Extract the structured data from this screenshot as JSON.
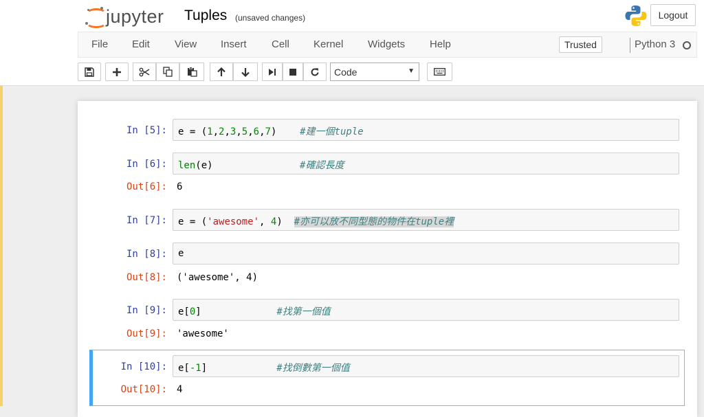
{
  "header": {
    "logo_text": "jupyter",
    "notebook_title": "Tuples",
    "autosave_status": "(unsaved changes)",
    "logout_label": "Logout"
  },
  "menubar": {
    "items": [
      "File",
      "Edit",
      "View",
      "Insert",
      "Cell",
      "Kernel",
      "Widgets",
      "Help"
    ],
    "trusted_label": "Trusted",
    "kernel_name": "Python 3"
  },
  "toolbar": {
    "cell_type": "Code",
    "cell_type_options": [
      "Code"
    ]
  },
  "cells": [
    {
      "in_prompt": "In [5]:",
      "tokens": [
        {
          "t": "e ",
          "c": "op"
        },
        {
          "t": "=",
          "c": "op"
        },
        {
          "t": " (",
          "c": "op"
        },
        {
          "t": "1",
          "c": "num"
        },
        {
          "t": ",",
          "c": "op"
        },
        {
          "t": "2",
          "c": "num"
        },
        {
          "t": ",",
          "c": "op"
        },
        {
          "t": "3",
          "c": "num"
        },
        {
          "t": ",",
          "c": "op"
        },
        {
          "t": "5",
          "c": "num"
        },
        {
          "t": ",",
          "c": "op"
        },
        {
          "t": "6",
          "c": "num"
        },
        {
          "t": ",",
          "c": "op"
        },
        {
          "t": "7",
          "c": "num"
        },
        {
          "t": ")    ",
          "c": "op"
        },
        {
          "t": "#建一個tuple",
          "c": "comment"
        }
      ],
      "out_prompt": "",
      "output": ""
    },
    {
      "in_prompt": "In [6]:",
      "tokens": [
        {
          "t": "len",
          "c": "fn"
        },
        {
          "t": "(e)               ",
          "c": "op"
        },
        {
          "t": "#確認長度",
          "c": "comment"
        }
      ],
      "out_prompt": "Out[6]:",
      "output": "6"
    },
    {
      "in_prompt": "In [7]:",
      "tokens": [
        {
          "t": "e ",
          "c": "op"
        },
        {
          "t": "=",
          "c": "op"
        },
        {
          "t": " (",
          "c": "op"
        },
        {
          "t": "'awesome'",
          "c": "str"
        },
        {
          "t": ", ",
          "c": "op"
        },
        {
          "t": "4",
          "c": "num"
        },
        {
          "t": ")  ",
          "c": "op"
        },
        {
          "t": "#亦可以放不同型態的物件在tuple裡",
          "c": "comment-hl"
        }
      ],
      "out_prompt": "",
      "output": ""
    },
    {
      "in_prompt": "In [8]:",
      "tokens": [
        {
          "t": "e",
          "c": "op"
        }
      ],
      "out_prompt": "Out[8]:",
      "output": "('awesome', 4)"
    },
    {
      "in_prompt": "In [9]:",
      "tokens": [
        {
          "t": "e[",
          "c": "op"
        },
        {
          "t": "0",
          "c": "num"
        },
        {
          "t": "]             ",
          "c": "op"
        },
        {
          "t": "#找第一個值",
          "c": "comment"
        }
      ],
      "out_prompt": "Out[9]:",
      "output": "'awesome'"
    },
    {
      "in_prompt": "In [10]:",
      "tokens": [
        {
          "t": "e[",
          "c": "op"
        },
        {
          "t": "-1",
          "c": "num"
        },
        {
          "t": "]            ",
          "c": "op"
        },
        {
          "t": "#找倒數第一個值",
          "c": "comment"
        }
      ],
      "out_prompt": "Out[10]:",
      "output": "4"
    }
  ]
}
